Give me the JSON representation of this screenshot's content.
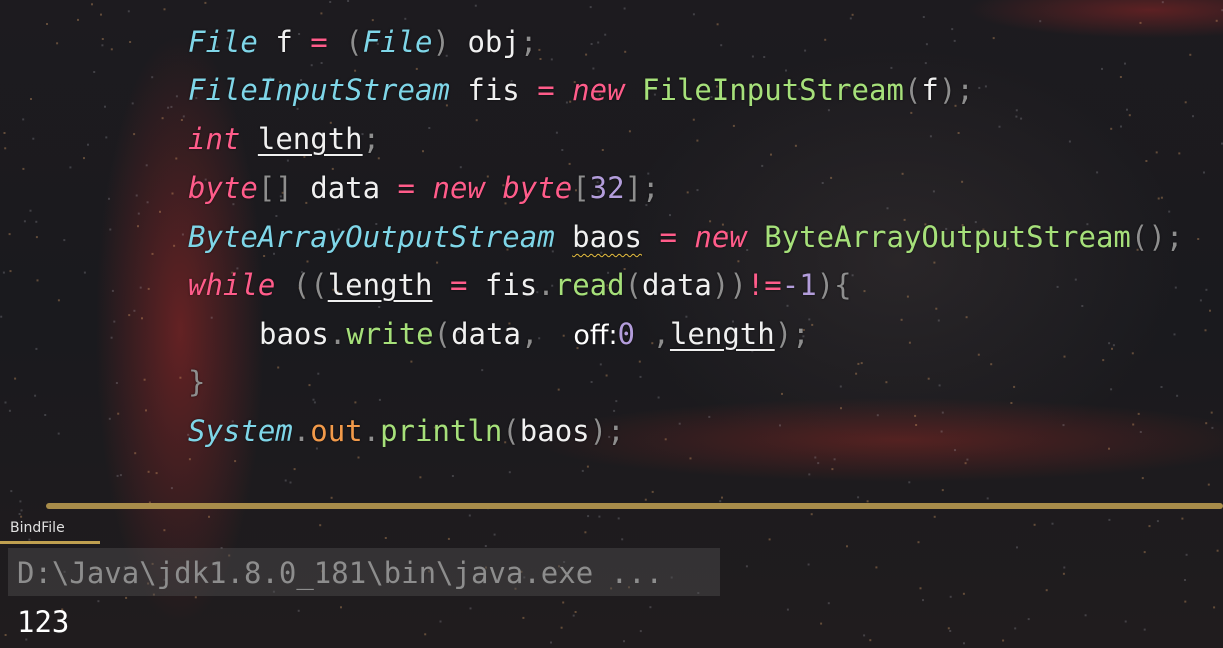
{
  "editor": {
    "line1": {
      "type1": "File",
      "var": "f",
      "eq": "=",
      "open": "(",
      "cast": "File",
      "close": ")",
      "obj": "obj",
      "semi": ";"
    },
    "line2": {
      "type": "FileInputStream",
      "var": "fis",
      "eq": "=",
      "kw": "new",
      "cls": "FileInputStream",
      "open": "(",
      "arg": "f",
      "close": ")",
      "semi": ";"
    },
    "line3": {
      "kw": "int",
      "var": "length",
      "semi": ";"
    },
    "line4": {
      "kw": "byte",
      "brackets": "[]",
      "var": "data",
      "eq": "=",
      "kw2": "new",
      "kw3": "byte",
      "open": "[",
      "num": "32",
      "close": "]",
      "semi": ";"
    },
    "line5": {
      "type": "ByteArrayOutputStream",
      "var": "baos",
      "eq": "=",
      "kw": "new",
      "cls": "ByteArrayOutputStream",
      "parens": "()",
      "semi": ";"
    },
    "line6": {
      "kw": "while",
      "open": "((",
      "var": "length",
      "eq": "=",
      "obj": "fis",
      "dot": ".",
      "method": "read",
      "popen": "(",
      "arg": "data",
      "pclose": "))",
      "neq": "!=",
      "num": "-1",
      "close": "){"
    },
    "line7": {
      "obj": "baos",
      "dot": ".",
      "method": "write",
      "popen": "(",
      "arg1": "data",
      "comma": ",",
      "hint": "off:",
      "num": "0",
      "comma2": ",",
      "arg3": "length",
      "close": ");"
    },
    "line8": {
      "brace": "}"
    },
    "line9": {
      "cls": "System",
      "dot": ".",
      "field": "out",
      "dot2": ".",
      "method": "println",
      "popen": "(",
      "arg": "baos",
      "close": ");"
    }
  },
  "run_panel": {
    "tab_label": "BindFile",
    "command": "D:\\Java\\jdk1.8.0_181\\bin\\java.exe ...",
    "output": "123"
  },
  "colors": {
    "accent_divider": "#a88c4a",
    "keyword": "#ff5c8a",
    "type": "#7fd6e8",
    "method": "#a6e07a",
    "number": "#b39ddb",
    "field": "#f29a4a"
  }
}
